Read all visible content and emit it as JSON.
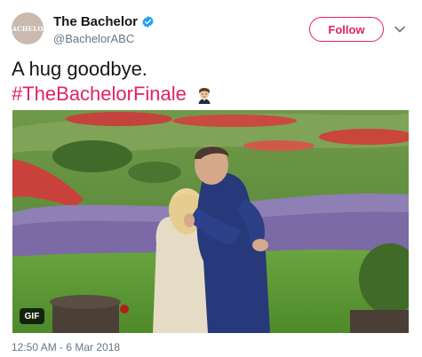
{
  "account": {
    "display_name": "The Bachelor",
    "handle": "@BachelorABC",
    "avatar_text": "BACHELOR",
    "verified": true
  },
  "actions": {
    "follow_label": "Follow",
    "more_icon": "chevron-down-icon"
  },
  "tweet": {
    "text_line1": "A hug goodbye.",
    "hashtag": "#TheBachelorFinale",
    "emoji": "bachelor-face-emoji"
  },
  "media": {
    "type": "gif",
    "badge_label": "GIF"
  },
  "meta": {
    "timestamp": "12:50 AM - 6 Mar 2018"
  },
  "colors": {
    "accent": "#e0245e",
    "verified_blue": "#1da1f2",
    "secondary_text": "#657786",
    "primary_text": "#14171a"
  }
}
